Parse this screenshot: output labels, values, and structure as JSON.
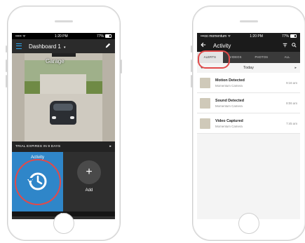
{
  "left_phone": {
    "status": {
      "carrier": "••••• ᯤ",
      "time": "1:20 PM",
      "battery": "77%"
    },
    "header": {
      "title": "Dashboard 1",
      "caret": "▾",
      "edit_icon": "pencil-icon"
    },
    "camera": {
      "name": "Garage"
    },
    "trial_banner": {
      "text": "TRIAL EXPIRES IN 9 DAYS",
      "arrow": "▸"
    },
    "tiles": [
      {
        "label": "Activity",
        "icon": "history-icon"
      },
      {
        "label": "Add",
        "icon": "plus-icon",
        "glyph": "+"
      }
    ],
    "pager": {
      "pages": 2,
      "current": 1
    },
    "colors": {
      "accent": "#2f86c9",
      "highlight": "#e24a4a"
    }
  },
  "right_phone": {
    "status": {
      "carrier": "•••oo momentum ᯤ",
      "time": "1:20 PM",
      "battery": "77%"
    },
    "header": {
      "title": "Activity",
      "back_icon": "back-arrow-icon",
      "filter_icon": "filter-icon",
      "search_icon": "search-icon"
    },
    "tabs": [
      "ALERTS",
      "VIDEOS",
      "PHOTOS",
      "ALL"
    ],
    "active_tab": "ALERTS",
    "day": {
      "label": "Today",
      "prev": "◂",
      "next": "▸"
    },
    "alerts": [
      {
        "title": "Motion Detected",
        "source": "Momentum Camera",
        "time": "9:16 am"
      },
      {
        "title": "Sound Detected",
        "source": "Momentum Camera",
        "time": "8:06 am"
      },
      {
        "title": "Video Captured",
        "source": "Momentum Camera",
        "time": "7:45 am"
      }
    ]
  }
}
